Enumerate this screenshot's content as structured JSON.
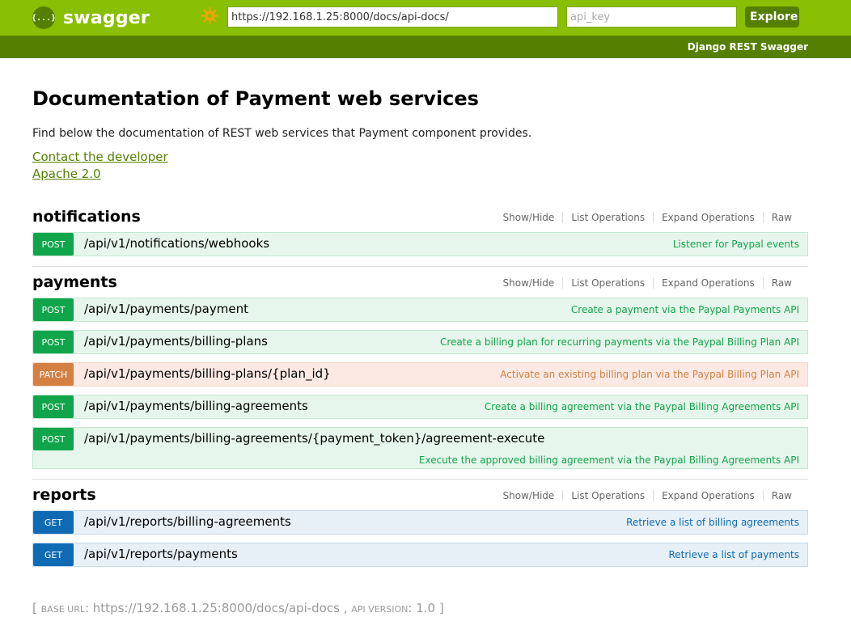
{
  "header": {
    "logo_text": "swagger",
    "logo_glyph": "{...}",
    "url_value": "https://192.168.1.25:8000/docs/api-docs/",
    "api_key_placeholder": "api_key",
    "explore_label": "Explore",
    "subtitle": "Django REST Swagger",
    "colors": {
      "bar": "#89bf04",
      "dark": "#547f00"
    }
  },
  "info": {
    "title": "Documentation of Payment web services",
    "description": "Find below the documentation of REST web services that Payment component provides.",
    "contact_label": "Contact the developer",
    "license_label": "Apache 2.0"
  },
  "resource_options": [
    "Show/Hide",
    "List Operations",
    "Expand Operations",
    "Raw"
  ],
  "resources": [
    {
      "name": "notifications",
      "operations": [
        {
          "method": "POST",
          "path": "/api/v1/notifications/webhooks",
          "summary": "Listener for Paypal events"
        }
      ]
    },
    {
      "name": "payments",
      "operations": [
        {
          "method": "POST",
          "path": "/api/v1/payments/payment",
          "summary": "Create a payment via the Paypal Payments API"
        },
        {
          "method": "POST",
          "path": "/api/v1/payments/billing-plans",
          "summary": "Create a billing plan for recurring payments via the Paypal Billing Plan API"
        },
        {
          "method": "PATCH",
          "path": "/api/v1/payments/billing-plans/{plan_id}",
          "summary": "Activate an existing billing plan via the Paypal Billing Plan API"
        },
        {
          "method": "POST",
          "path": "/api/v1/payments/billing-agreements",
          "summary": "Create a billing agreement via the Paypal Billing Agreements API"
        },
        {
          "method": "POST",
          "path": "/api/v1/payments/billing-agreements/{payment_token}/agreement-execute",
          "summary": "Execute the approved billing agreement via the Paypal Billing Agreements API"
        }
      ]
    },
    {
      "name": "reports",
      "operations": [
        {
          "method": "GET",
          "path": "/api/v1/reports/billing-agreements",
          "summary": "Retrieve a list of billing agreements"
        },
        {
          "method": "GET",
          "path": "/api/v1/reports/payments",
          "summary": "Retrieve a list of payments"
        }
      ]
    }
  ],
  "footer": {
    "open_bracket": "[",
    "base_url_label": "base url",
    "base_url": "https://192.168.1.25:8000/docs/api-docs",
    "separator": ",",
    "api_version_label": "api version",
    "api_version": "1.0",
    "close_bracket": "]"
  },
  "method_colors": {
    "POST": "#10a54a",
    "PATCH": "#d38042",
    "GET": "#0f6ab4"
  }
}
